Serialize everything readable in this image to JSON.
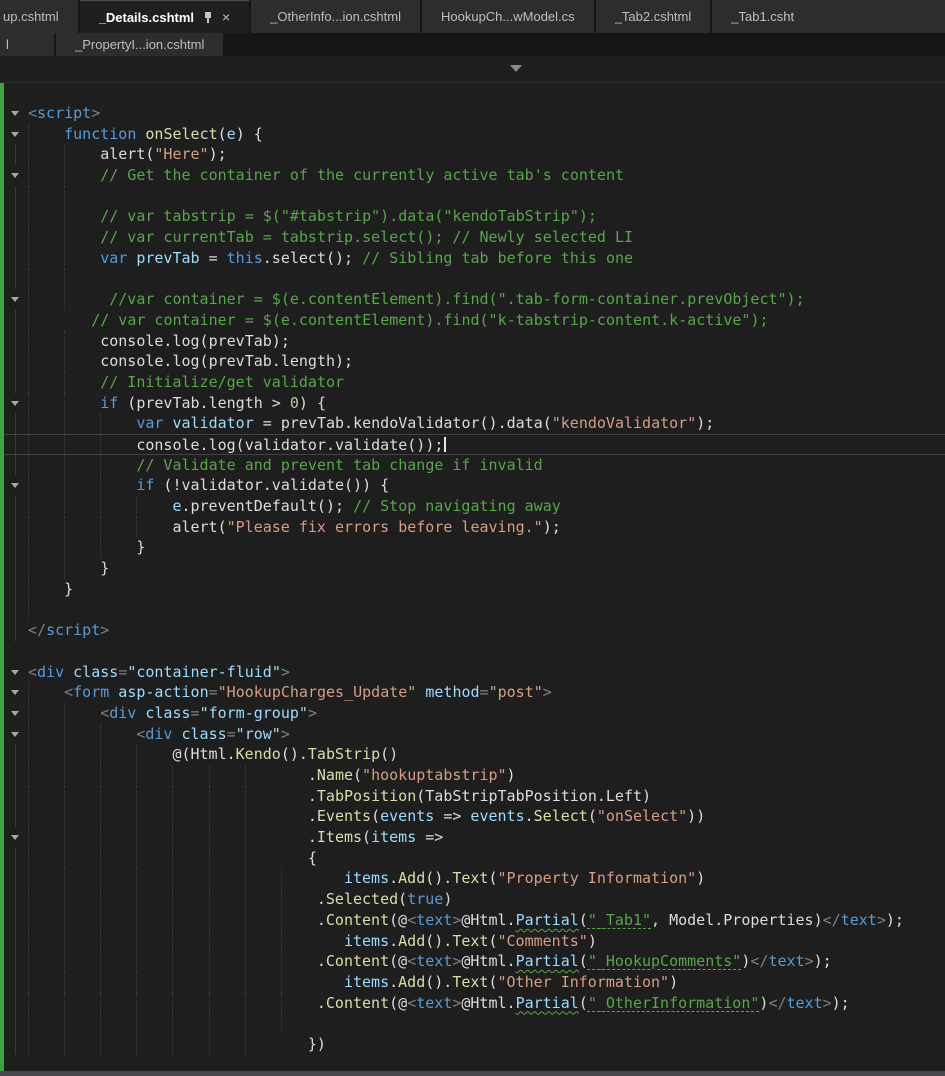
{
  "tab_bar": {
    "rows": [
      {
        "tabs": [
          {
            "label": "up.cshtml",
            "state": "inactive",
            "cut": "left"
          },
          {
            "label": "_Details.cshtml",
            "state": "active",
            "pinned": true,
            "closable": true
          },
          {
            "label": "_OtherInfo...ion.cshtml",
            "state": "inactive"
          },
          {
            "label": "HookupCh...wModel.cs",
            "state": "inactive"
          },
          {
            "label": "_Tab2.cshtml",
            "state": "inactive"
          },
          {
            "label": "_Tab1.csht",
            "state": "inactive",
            "cut": "right"
          }
        ]
      },
      {
        "tabs": [
          {
            "label": "l",
            "state": "inactive",
            "stub": true
          },
          {
            "label": "_PropertyI...ion.cshtml",
            "state": "inactive"
          }
        ]
      }
    ],
    "icons": {
      "close": "×",
      "pin": "pushpin",
      "overflow_caret": "triangle-down",
      "fold": "triangle-down"
    }
  },
  "colors": {
    "editor_bg": "#1E1E1E",
    "keyword": "#569CD6",
    "string": "#D69D85",
    "comment": "#57A64A",
    "method": "#DCDCAA",
    "parameter": "#9CDCFE",
    "html_tag": "#569CD6",
    "change_bar_green": "#3FA33F"
  },
  "editor": {
    "lines": [
      {
        "g": "v",
        "ind": 0,
        "seg": [
          [
            "p",
            "<"
          ],
          [
            "t",
            "script"
          ],
          [
            "p",
            ">"
          ]
        ]
      },
      {
        "g": "v",
        "ind": 4,
        "seg": [
          [
            "k",
            "function"
          ],
          [
            "d",
            " "
          ],
          [
            "m",
            "onSelect"
          ],
          [
            "d",
            "("
          ],
          [
            "v",
            "e"
          ],
          [
            "d",
            ") {"
          ]
        ]
      },
      {
        "g": "l",
        "ind": 8,
        "seg": [
          [
            "d",
            "alert("
          ],
          [
            "s",
            "\"Here\""
          ],
          [
            "d",
            ");"
          ]
        ]
      },
      {
        "g": "v",
        "ind": 8,
        "seg": [
          [
            "c",
            "// Get the container of the currently active tab's content"
          ]
        ]
      },
      {
        "g": "l",
        "ind": 8,
        "seg": []
      },
      {
        "g": "l",
        "ind": 8,
        "seg": [
          [
            "c",
            "// var tabstrip = $(\"#tabstrip\").data(\"kendoTabStrip\");"
          ]
        ]
      },
      {
        "g": "l",
        "ind": 8,
        "seg": [
          [
            "c",
            "// var currentTab = tabstrip.select(); // Newly selected LI"
          ]
        ]
      },
      {
        "g": "l",
        "ind": 8,
        "seg": [
          [
            "k",
            "var"
          ],
          [
            "d",
            " "
          ],
          [
            "v",
            "prevTab"
          ],
          [
            "d",
            " = "
          ],
          [
            "k",
            "this"
          ],
          [
            "d",
            ".select(); "
          ],
          [
            "c",
            "// Sibling tab before this one"
          ]
        ]
      },
      {
        "g": "l",
        "ind": 8,
        "seg": []
      },
      {
        "g": "v",
        "ind": 9,
        "seg": [
          [
            "c",
            "//var container = $(e.contentElement).find(\".tab-form-container.prevObject\");"
          ]
        ]
      },
      {
        "g": "l",
        "ind": 7,
        "seg": [
          [
            "c",
            "// var container = $(e.contentElement).find(\"k-tabstrip-content.k-active\");"
          ]
        ]
      },
      {
        "g": "l",
        "ind": 8,
        "seg": [
          [
            "d",
            "console.log(prevTab);"
          ]
        ]
      },
      {
        "g": "l",
        "ind": 8,
        "seg": [
          [
            "d",
            "console.log(prevTab.length);"
          ]
        ]
      },
      {
        "g": "l",
        "ind": 8,
        "seg": [
          [
            "c",
            "// Initialize/get validator"
          ]
        ]
      },
      {
        "g": "v",
        "ind": 8,
        "seg": [
          [
            "k",
            "if"
          ],
          [
            "d",
            " (prevTab.length > "
          ],
          [
            "n",
            "0"
          ],
          [
            "d",
            ") {"
          ]
        ]
      },
      {
        "g": "l",
        "ind": 12,
        "seg": [
          [
            "k",
            "var"
          ],
          [
            "d",
            " "
          ],
          [
            "v",
            "validator"
          ],
          [
            "d",
            " = prevTab.kendoValidator().data("
          ],
          [
            "s",
            "\"kendoValidator\""
          ],
          [
            "d",
            ");"
          ]
        ]
      },
      {
        "g": "l",
        "ind": 12,
        "cur": true,
        "caret": true,
        "seg": [
          [
            "d",
            "console.log(validator.validate());"
          ]
        ]
      },
      {
        "g": "l",
        "ind": 12,
        "seg": [
          [
            "c",
            "// Validate and prevent tab change if invalid"
          ]
        ]
      },
      {
        "g": "v",
        "ind": 12,
        "seg": [
          [
            "k",
            "if"
          ],
          [
            "d",
            " (!validator.validate()) {"
          ]
        ]
      },
      {
        "g": "l",
        "ind": 16,
        "seg": [
          [
            "v",
            "e"
          ],
          [
            "d",
            ".preventDefault(); "
          ],
          [
            "c",
            "// Stop navigating away"
          ]
        ]
      },
      {
        "g": "l",
        "ind": 16,
        "seg": [
          [
            "d",
            "alert("
          ],
          [
            "s",
            "\"Please fix errors before leaving.\""
          ],
          [
            "d",
            ");"
          ]
        ]
      },
      {
        "g": "l",
        "ind": 12,
        "seg": [
          [
            "d",
            "}"
          ]
        ]
      },
      {
        "g": "l",
        "ind": 8,
        "seg": [
          [
            "d",
            "}"
          ]
        ]
      },
      {
        "g": "l",
        "ind": 4,
        "seg": [
          [
            "d",
            "}"
          ]
        ]
      },
      {
        "g": "l",
        "ind": 4,
        "seg": []
      },
      {
        "g": "l",
        "ind": 0,
        "seg": [
          [
            "p",
            "</"
          ],
          [
            "t",
            "script"
          ],
          [
            "p",
            ">"
          ]
        ]
      },
      {
        "g": "",
        "ind": 0,
        "seg": []
      },
      {
        "g": "v",
        "ind": 0,
        "seg": [
          [
            "p",
            "<"
          ],
          [
            "t",
            "div"
          ],
          [
            "d",
            " "
          ],
          [
            "a",
            "class"
          ],
          [
            "p",
            "="
          ],
          [
            "a",
            "\"container-fluid\""
          ],
          [
            "p",
            ">"
          ]
        ]
      },
      {
        "g": "v",
        "ind": 4,
        "seg": [
          [
            "p",
            "<"
          ],
          [
            "t",
            "form"
          ],
          [
            "d",
            " "
          ],
          [
            "a",
            "asp-action"
          ],
          [
            "p",
            "="
          ],
          [
            "s",
            "\"HookupCharges_Update\""
          ],
          [
            "d",
            " "
          ],
          [
            "a",
            "method"
          ],
          [
            "p",
            "="
          ],
          [
            "s",
            "\"post\""
          ],
          [
            "p",
            ">"
          ]
        ]
      },
      {
        "g": "v",
        "ind": 8,
        "seg": [
          [
            "p",
            "<"
          ],
          [
            "t",
            "div"
          ],
          [
            "d",
            " "
          ],
          [
            "a",
            "class"
          ],
          [
            "p",
            "="
          ],
          [
            "a",
            "\"form-group\""
          ],
          [
            "p",
            ">"
          ]
        ]
      },
      {
        "g": "v",
        "ind": 12,
        "seg": [
          [
            "p",
            "<"
          ],
          [
            "t",
            "div"
          ],
          [
            "d",
            " "
          ],
          [
            "a",
            "class"
          ],
          [
            "p",
            "="
          ],
          [
            "a",
            "\"row\""
          ],
          [
            "p",
            ">"
          ]
        ]
      },
      {
        "g": "l",
        "ind": 16,
        "seg": [
          [
            "d",
            "@(Html."
          ],
          [
            "m",
            "Kendo"
          ],
          [
            "d",
            "()."
          ],
          [
            "m",
            "TabStrip"
          ],
          [
            "d",
            "()"
          ]
        ]
      },
      {
        "g": "l",
        "ind": 31,
        "seg": [
          [
            "d",
            "."
          ],
          [
            "m",
            "Name"
          ],
          [
            "d",
            "("
          ],
          [
            "s",
            "\"hookuptabstrip\""
          ],
          [
            "d",
            ")"
          ]
        ]
      },
      {
        "g": "l",
        "ind": 31,
        "seg": [
          [
            "d",
            "."
          ],
          [
            "m",
            "TabPosition"
          ],
          [
            "d",
            "(TabStripTabPosition.Left)"
          ]
        ]
      },
      {
        "g": "l",
        "ind": 31,
        "seg": [
          [
            "d",
            "."
          ],
          [
            "m",
            "Events"
          ],
          [
            "d",
            "("
          ],
          [
            "v",
            "events"
          ],
          [
            "d",
            " => "
          ],
          [
            "v",
            "events"
          ],
          [
            "d",
            "."
          ],
          [
            "m",
            "Select"
          ],
          [
            "d",
            "("
          ],
          [
            "s",
            "\"onSelect\""
          ],
          [
            "d",
            "))"
          ]
        ]
      },
      {
        "g": "v",
        "ind": 31,
        "seg": [
          [
            "d",
            "."
          ],
          [
            "m",
            "Items"
          ],
          [
            "d",
            "("
          ],
          [
            "v",
            "items"
          ],
          [
            "d",
            " =>"
          ]
        ]
      },
      {
        "g": "l",
        "ind": 31,
        "seg": [
          [
            "d",
            "{"
          ]
        ]
      },
      {
        "g": "l",
        "ind": 35,
        "seg": [
          [
            "v",
            "items"
          ],
          [
            "d",
            "."
          ],
          [
            "m",
            "Add"
          ],
          [
            "d",
            "()."
          ],
          [
            "m",
            "Text"
          ],
          [
            "d",
            "("
          ],
          [
            "s",
            "\"Property Information\""
          ],
          [
            "d",
            ")"
          ]
        ]
      },
      {
        "g": "l",
        "ind": 32,
        "seg": [
          [
            "d",
            "."
          ],
          [
            "m",
            "Selected"
          ],
          [
            "d",
            "("
          ],
          [
            "k",
            "true"
          ],
          [
            "d",
            ")"
          ]
        ]
      },
      {
        "g": "l",
        "ind": 32,
        "seg": [
          [
            "d",
            "."
          ],
          [
            "m",
            "Content"
          ],
          [
            "d",
            "(@"
          ],
          [
            "p",
            "<"
          ],
          [
            "t",
            "text"
          ],
          [
            "p",
            ">"
          ],
          [
            "d",
            "@Html."
          ],
          [
            "w",
            "Partial"
          ],
          [
            "d",
            "("
          ],
          [
            "u",
            "\"_Tab1\""
          ],
          [
            "d",
            ", Model.Properties)"
          ],
          [
            "p",
            "</"
          ],
          [
            "t",
            "text"
          ],
          [
            "p",
            ">"
          ],
          [
            "d",
            ");"
          ]
        ]
      },
      {
        "g": "l",
        "ind": 35,
        "seg": [
          [
            "v",
            "items"
          ],
          [
            "d",
            "."
          ],
          [
            "m",
            "Add"
          ],
          [
            "d",
            "()."
          ],
          [
            "m",
            "Text"
          ],
          [
            "d",
            "("
          ],
          [
            "s",
            "\"Comments\""
          ],
          [
            "d",
            ")"
          ]
        ]
      },
      {
        "g": "l",
        "ind": 32,
        "seg": [
          [
            "d",
            "."
          ],
          [
            "m",
            "Content"
          ],
          [
            "d",
            "(@"
          ],
          [
            "p",
            "<"
          ],
          [
            "t",
            "text"
          ],
          [
            "p",
            ">"
          ],
          [
            "d",
            "@Html."
          ],
          [
            "w",
            "Partial"
          ],
          [
            "d",
            "("
          ],
          [
            "u",
            "\"_HookupComments\""
          ],
          [
            "d",
            ")"
          ],
          [
            "p",
            "</"
          ],
          [
            "t",
            "text"
          ],
          [
            "p",
            ">"
          ],
          [
            "d",
            ");"
          ]
        ]
      },
      {
        "g": "l",
        "ind": 35,
        "seg": [
          [
            "v",
            "items"
          ],
          [
            "d",
            "."
          ],
          [
            "m",
            "Add"
          ],
          [
            "d",
            "()."
          ],
          [
            "m",
            "Text"
          ],
          [
            "d",
            "("
          ],
          [
            "s",
            "\"Other Information\""
          ],
          [
            "d",
            ")"
          ]
        ]
      },
      {
        "g": "l",
        "ind": 32,
        "seg": [
          [
            "d",
            "."
          ],
          [
            "m",
            "Content"
          ],
          [
            "d",
            "(@"
          ],
          [
            "p",
            "<"
          ],
          [
            "t",
            "text"
          ],
          [
            "p",
            ">"
          ],
          [
            "d",
            "@Html."
          ],
          [
            "w",
            "Partial"
          ],
          [
            "d",
            "("
          ],
          [
            "u",
            "\"_OtherInformation\""
          ],
          [
            "d",
            ")"
          ],
          [
            "p",
            "</"
          ],
          [
            "t",
            "text"
          ],
          [
            "p",
            ">"
          ],
          [
            "d",
            ");"
          ]
        ]
      },
      {
        "g": "l",
        "ind": 32,
        "seg": []
      },
      {
        "g": "l",
        "ind": 31,
        "seg": [
          [
            "d",
            "})"
          ]
        ]
      },
      {
        "g": "",
        "ind": 0,
        "seg": []
      }
    ]
  }
}
